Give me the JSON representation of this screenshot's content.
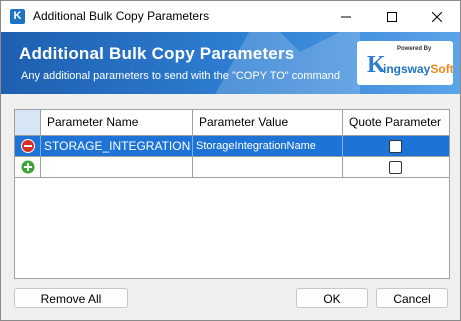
{
  "window": {
    "title": "Additional Bulk Copy Parameters",
    "icon": "kingsway-app-icon"
  },
  "banner": {
    "title": "Additional Bulk Copy Parameters",
    "subtitle": "Any additional parameters to send with the \"COPY TO\" command",
    "logo": {
      "powered_by": "Powered By",
      "k_letter": "K",
      "kingsway": "ingsway",
      "soft": "Soft"
    }
  },
  "grid": {
    "columns": [
      "Parameter Name",
      "Parameter Value",
      "Quote Parameter"
    ],
    "rows": [
      {
        "name": "STORAGE_INTEGRATION",
        "value": "StorageIntegrationName",
        "quote": false,
        "handle_icon": "remove-row-icon",
        "selected": true
      },
      {
        "name": "",
        "value": "",
        "quote": false,
        "handle_icon": "add-row-icon",
        "selected": false
      }
    ]
  },
  "buttons": {
    "remove_all": "Remove All",
    "ok": "OK",
    "cancel": "Cancel"
  },
  "colors": {
    "banner": "#2f80d4",
    "selection": "#1e74d6",
    "remove_icon": "#d93025",
    "add_icon": "#3aa635",
    "logo_orange": "#f08a1e"
  }
}
